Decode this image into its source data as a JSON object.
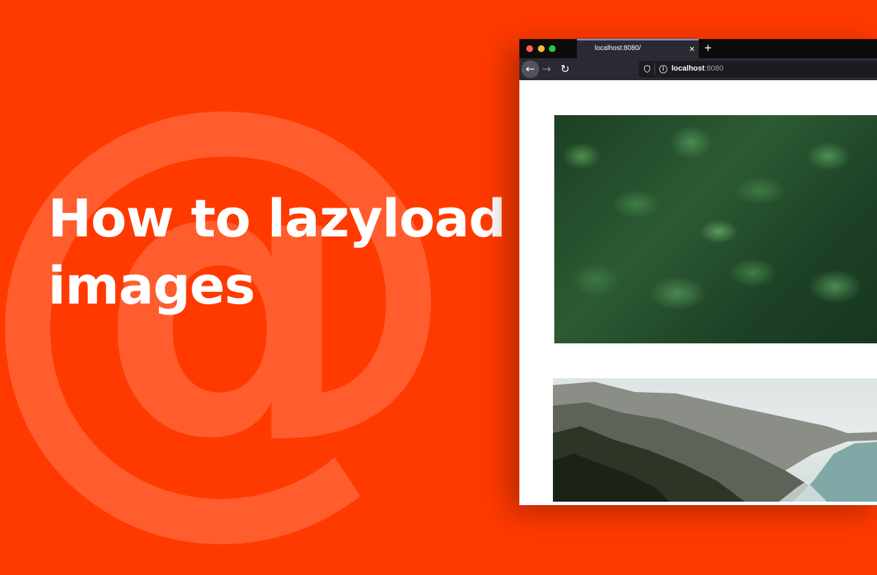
{
  "background": {
    "color": "#ff3a00",
    "watermark_glyph": "@"
  },
  "headline": {
    "line1": "How to lazyload",
    "line2": "images"
  },
  "browser": {
    "traffic_lights": [
      "#ff5f57",
      "#febc2e",
      "#28c840"
    ],
    "tab": {
      "title": "localhost:8080/",
      "close_glyph": "×"
    },
    "new_tab_glyph": "+",
    "nav": {
      "back_glyph": "←",
      "forward_glyph": "→",
      "reload_glyph": "↻"
    },
    "url": {
      "host": "localhost",
      "port": ":8080"
    }
  },
  "content": {
    "images": [
      {
        "subject": "fern-foliage"
      },
      {
        "subject": "coastal-cliffs"
      }
    ]
  }
}
